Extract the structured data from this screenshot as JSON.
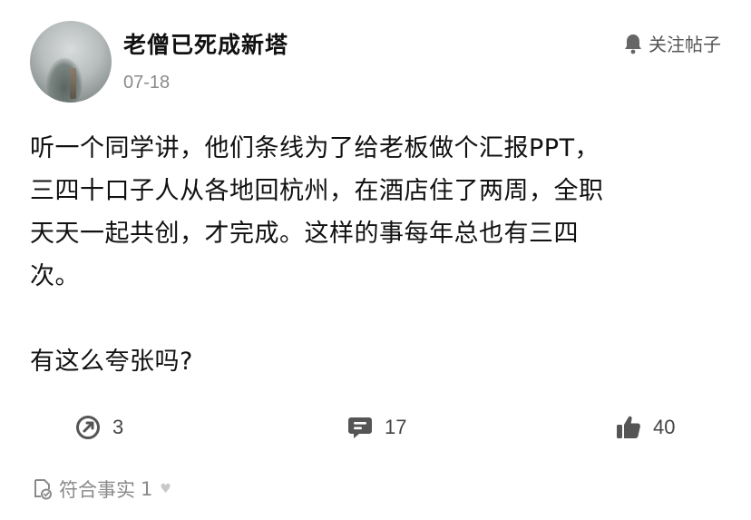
{
  "post": {
    "author": {
      "name": "老僧已死成新塔",
      "avatar_icon": "avatar-misty-tree"
    },
    "date": "07-18",
    "follow": {
      "icon": "bell-icon",
      "label": "关注帖子"
    },
    "content": {
      "lines": [
        "听一个同学讲，他们条线为了给老板做个汇报PPT，",
        "三四十口子人从各地回杭州，在酒店住了两周，全职",
        "天天一起共创，才完成。这样的事每年总也有三四",
        "次。"
      ],
      "question": "有这么夸张吗?"
    },
    "actions": {
      "share": {
        "icon": "share-icon",
        "count": "3"
      },
      "comment": {
        "icon": "comment-icon",
        "count": "17"
      },
      "like": {
        "icon": "thumbs-up-icon",
        "count": "40"
      }
    },
    "tag": {
      "icon": "fact-check-icon",
      "label": "符合事实",
      "count": "1",
      "heart_icon": "heart-icon"
    }
  },
  "colors": {
    "text": "#111111",
    "muted": "#8a8a8a",
    "icon": "#444444"
  }
}
